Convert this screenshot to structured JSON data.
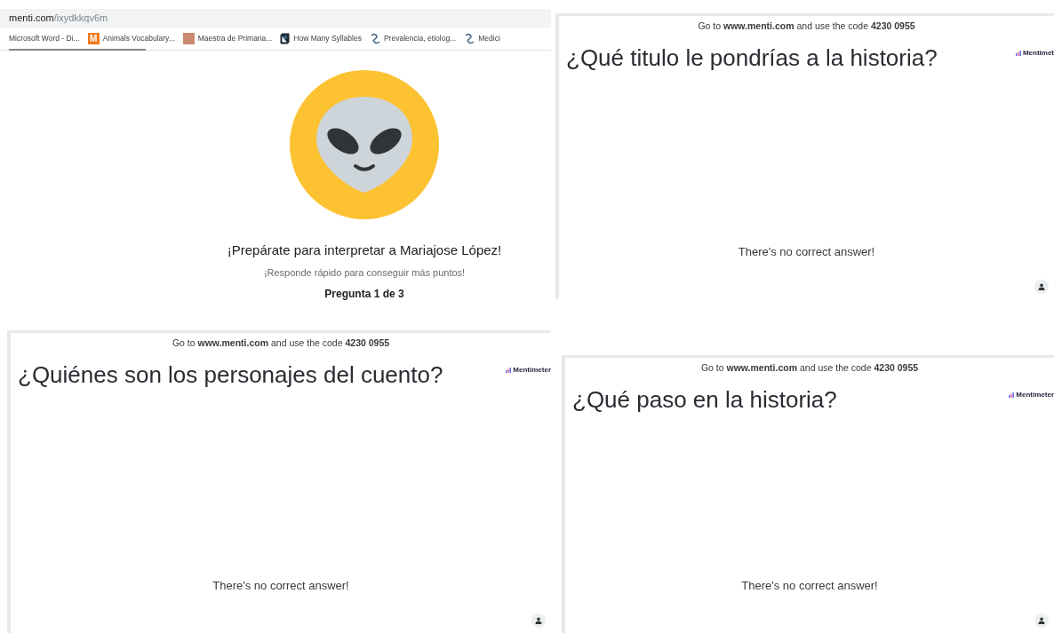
{
  "panels": [
    {
      "kind": "join",
      "address": {
        "host": "menti.com",
        "path": "/ixydkkqv6m"
      },
      "bookmarks": [
        {
          "label": "Microsoft Word - Di...",
          "kind": "plain"
        },
        {
          "label": "Animals Vocabulary...",
          "kind": "letter",
          "glyph": "M"
        },
        {
          "label": "Maestra de Primaria...",
          "kind": "photo"
        },
        {
          "label": "How Many Syllables",
          "kind": "book"
        },
        {
          "label": "Prevalencia, etiolog...",
          "kind": "swirl"
        },
        {
          "label": "Medici",
          "kind": "swirl"
        }
      ],
      "title": "¡Prepárate para interpretar a Mariajose López!",
      "subtitle": "¡Responde rápido para conseguir más puntos!",
      "progress": "Pregunta 1 de 3"
    },
    {
      "kind": "slide",
      "instruction": "Go to **www.menti.com** and use the code **4230 0955**",
      "question": "¿Qué titulo le pondrías a la historia?",
      "brand": "Mentimet",
      "footer": "There's no correct answer!"
    },
    {
      "kind": "slide",
      "instruction": "Go to **www.menti.com** and use the code **4230 0955**",
      "question": "¿Quiénes son los personajes del cuento?",
      "brand": "Mentimeter",
      "footer": "There's no correct answer!"
    },
    {
      "kind": "slide",
      "instruction": "Go to **www.menti.com** and use the code **4230 0955**",
      "question": "¿Qué paso en la historia?",
      "brand": "Mentimeter",
      "footer": "There's no correct answer!"
    }
  ]
}
